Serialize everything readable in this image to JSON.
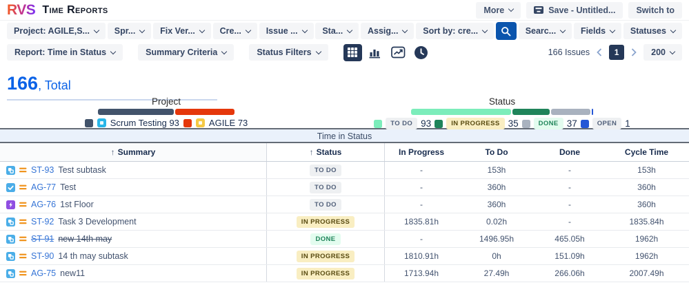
{
  "header": {
    "logo_text": "RVS",
    "app_title": "Time Reports",
    "buttons": [
      {
        "label": "More",
        "chevron": true
      },
      {
        "label": "Save - Untitled...",
        "icon": "save-icon"
      },
      {
        "label": "Switch to"
      }
    ]
  },
  "filter_bar": {
    "dropdowns": [
      "Project: AGILE,S...",
      "Spr...",
      "Fix Ver...",
      "Cre...",
      "Issue ...",
      "Sta...",
      "Assig...",
      "Sort by: cre..."
    ],
    "search_icon": "search-icon",
    "right_dropdowns": [
      "Searc...",
      "Fields",
      "Statuses"
    ]
  },
  "report_bar": {
    "dropdowns": [
      "Report: Time in Status",
      "Summary Criteria",
      "Status Filters"
    ],
    "view_toggles": [
      {
        "name": "table-view-icon",
        "selected": true
      },
      {
        "name": "bar-chart-view-icon",
        "selected": false
      },
      {
        "name": "line-chart-view-icon",
        "selected": false
      },
      {
        "name": "clock-view-icon",
        "selected": false
      }
    ],
    "issues_count": "166 Issues",
    "current_page": "1",
    "page_size": "200"
  },
  "summary": {
    "total_value": "166",
    "total_label": ", Total"
  },
  "legends": {
    "project": {
      "title": "Project",
      "items": [
        {
          "label": "Scrum Testing",
          "count": 93,
          "color": "#42536b",
          "avatar_color": "#29b6e8"
        },
        {
          "label": "AGILE",
          "count": 73,
          "color": "#e5370b",
          "avatar_color": "#f5c944"
        }
      ]
    },
    "status": {
      "title": "Status",
      "items": [
        {
          "label": "TO DO",
          "count": 93,
          "color": "#7cedbb",
          "badge": "todo"
        },
        {
          "label": "IN PROGRESS",
          "count": 35,
          "color": "#1f845a",
          "badge": "inprogress"
        },
        {
          "label": "DONE",
          "count": 37,
          "color": "#a9b2bf",
          "badge": "done"
        },
        {
          "label": "OPEN",
          "count": 1,
          "color": "#2557d6",
          "badge": "open"
        }
      ]
    }
  },
  "table": {
    "band_title": "Time in Status",
    "columns": [
      {
        "label": "Summary",
        "sorted": true
      },
      {
        "label": "Status",
        "sorted": true
      },
      {
        "label": "In Progress",
        "sorted": false
      },
      {
        "label": "To Do",
        "sorted": false
      },
      {
        "label": "Done",
        "sorted": false
      },
      {
        "label": "Cycle Time",
        "sorted": false
      }
    ],
    "rows": [
      {
        "type": "subtask",
        "key": "ST-93",
        "summary": "Test subtask",
        "status": "TO DO",
        "struck": false,
        "in_progress": "-",
        "to_do": "153h",
        "done": "-",
        "cycle_time": "153h"
      },
      {
        "type": "task",
        "key": "AG-77",
        "summary": "Test",
        "status": "TO DO",
        "struck": false,
        "in_progress": "-",
        "to_do": "360h",
        "done": "-",
        "cycle_time": "360h"
      },
      {
        "type": "bolt",
        "key": "AG-76",
        "summary": "1st Floor",
        "status": "TO DO",
        "struck": false,
        "in_progress": "-",
        "to_do": "360h",
        "done": "-",
        "cycle_time": "360h"
      },
      {
        "type": "subtask",
        "key": "ST-92",
        "summary": "Task 3 Development",
        "status": "IN PROGRESS",
        "struck": false,
        "in_progress": "1835.81h",
        "to_do": "0.02h",
        "done": "-",
        "cycle_time": "1835.84h"
      },
      {
        "type": "subtask",
        "key": "ST-91",
        "summary": "new 14th may",
        "status": "DONE",
        "struck": true,
        "in_progress": "-",
        "to_do": "1496.95h",
        "done": "465.05h",
        "cycle_time": "1962h"
      },
      {
        "type": "subtask",
        "key": "ST-90",
        "summary": "14 th may subtask",
        "status": "IN PROGRESS",
        "struck": false,
        "in_progress": "1810.91h",
        "to_do": "0h",
        "done": "151.09h",
        "cycle_time": "1962h"
      },
      {
        "type": "subtask",
        "key": "AG-75",
        "summary": "new11",
        "status": "IN PROGRESS",
        "struck": false,
        "in_progress": "1713.94h",
        "to_do": "27.49h",
        "done": "266.06h",
        "cycle_time": "2007.49h"
      }
    ]
  },
  "colors": {
    "accent_blue": "#0c63e7",
    "navy": "#253858",
    "search_blue": "#0b55ad",
    "project_scrum": "#42536b",
    "project_agile": "#e5370b",
    "status_todo_bar": "#7cedbb",
    "status_inprogress_bar": "#1f845a",
    "status_done_bar": "#a9b2bf",
    "status_open_bar": "#2557d6",
    "badge_todo_bg": "#eef0f2",
    "badge_inprogress_bg": "#f9eec2",
    "badge_done_bg": "#e3fcef"
  }
}
